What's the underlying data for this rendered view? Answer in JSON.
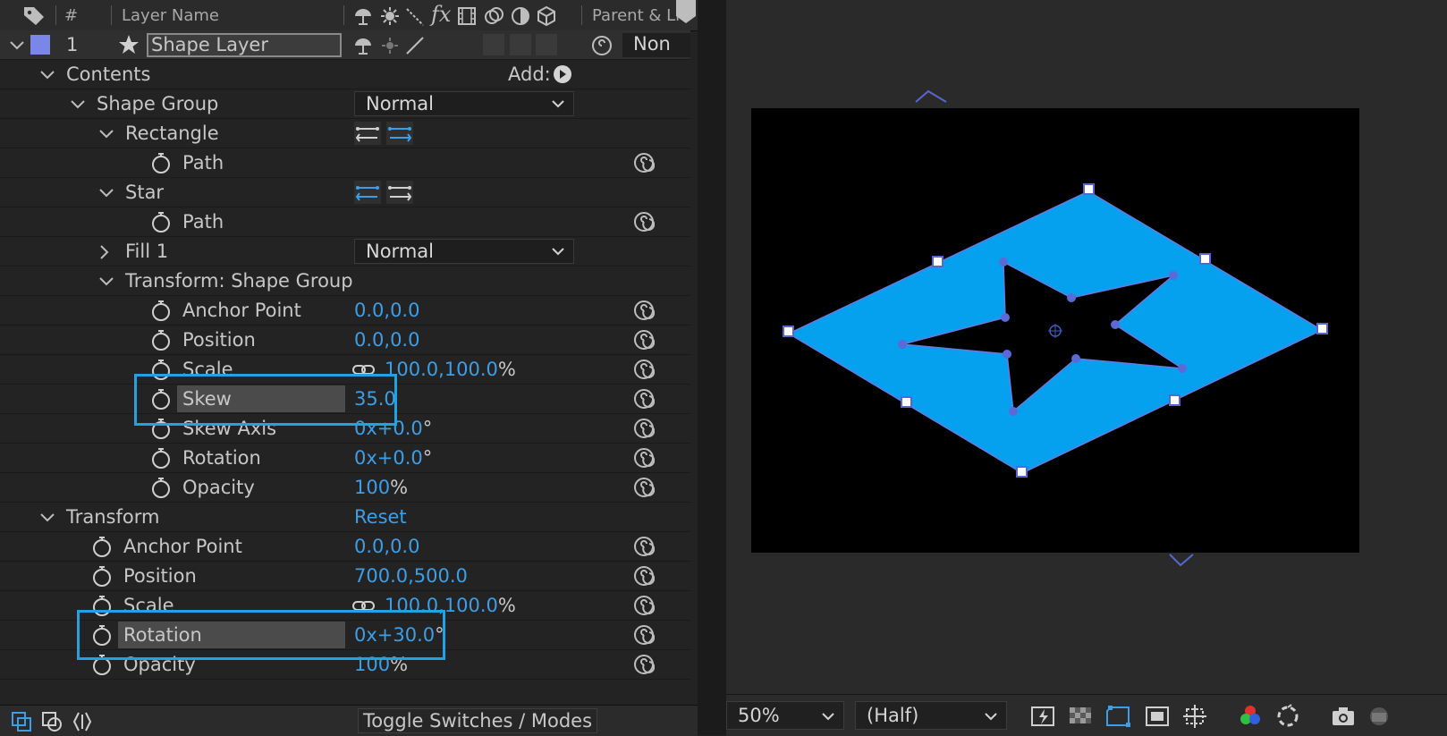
{
  "header": {
    "col_num": "#",
    "col_name": "Layer Name",
    "col_parent": "Parent & Li"
  },
  "layer": {
    "number": "1",
    "name": "Shape Layer",
    "parent": "Non"
  },
  "contents": {
    "label": "Contents",
    "add_label": "Add:"
  },
  "shape_group": {
    "label": "Shape Group",
    "blend": "Normal"
  },
  "rectangle": {
    "label": "Rectangle",
    "path_label": "Path"
  },
  "star": {
    "label": "Star",
    "path_label": "Path"
  },
  "fill": {
    "label": "Fill 1",
    "blend": "Normal"
  },
  "group_transform": {
    "label": "Transform: Shape Group",
    "anchor_label": "Anchor Point",
    "anchor_value": "0.0,0.0",
    "position_label": "Position",
    "position_value": "0.0,0.0",
    "scale_label": "Scale",
    "scale_value": "100.0,100.0",
    "scale_unit": "%",
    "skew_label": "Skew",
    "skew_value": "35.0",
    "skew_axis_label": "Skew Axis",
    "skew_axis_value": "+0.0",
    "skew_axis_prefix": "0x",
    "skew_axis_unit": "°",
    "rotation_label": "Rotation",
    "rotation_value": "+0.0",
    "rotation_prefix": "0x",
    "rotation_unit": "°",
    "opacity_label": "Opacity",
    "opacity_value": "100",
    "opacity_unit": "%"
  },
  "layer_transform": {
    "label": "Transform",
    "reset_label": "Reset",
    "anchor_label": "Anchor Point",
    "anchor_value": "0.0,0.0",
    "position_label": "Position",
    "position_value": "700.0,500.0",
    "scale_label": "Scale",
    "scale_value": "100.0,100.0",
    "scale_unit": "%",
    "rotation_label": "Rotation",
    "rotation_value": "+30.0",
    "rotation_prefix": "0x",
    "rotation_unit": "°",
    "opacity_label": "Opacity",
    "opacity_value": "100",
    "opacity_unit": "%"
  },
  "bottom": {
    "toggle_label": "Toggle Switches / Modes"
  },
  "viewer": {
    "zoom": "50%",
    "resolution": "(Half)"
  },
  "colors": {
    "accent": "#3d9ee8",
    "highlight": "#1fa3e5",
    "shape_fill": "#05a0ee",
    "label_swatch": "#7a86e8",
    "star_points": "#5b6ad6"
  }
}
